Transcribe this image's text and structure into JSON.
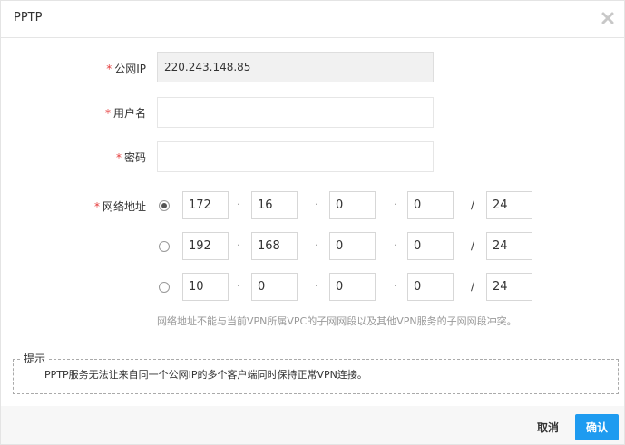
{
  "dialog": {
    "title": "PPTP",
    "close_icon": "close-x-icon"
  },
  "form": {
    "required_mark": "*",
    "public_ip": {
      "label": "公网IP",
      "value": "220.243.148.85"
    },
    "username": {
      "label": "用户名",
      "value": ""
    },
    "password": {
      "label": "密码",
      "value": ""
    },
    "network": {
      "label": "网络地址",
      "selected_index": 0,
      "separator": "·",
      "slash": "/",
      "options": [
        {
          "octets": [
            "172",
            "16",
            "0",
            "0"
          ],
          "mask": "24"
        },
        {
          "octets": [
            "192",
            "168",
            "0",
            "0"
          ],
          "mask": "24"
        },
        {
          "octets": [
            "10",
            "0",
            "0",
            "0"
          ],
          "mask": "24"
        }
      ],
      "hint": "网络地址不能与当前VPN所属VPC的子网网段以及其他VPN服务的子网网段冲突。"
    }
  },
  "tip": {
    "title": "提示",
    "text": "PPTP服务无法让来自同一个公网IP的多个客户端同时保持正常VPN连接。"
  },
  "footer": {
    "cancel_label": "取消",
    "confirm_label": "确认"
  },
  "colors": {
    "accent": "#1e9bf0",
    "required": "#e43a3a"
  }
}
